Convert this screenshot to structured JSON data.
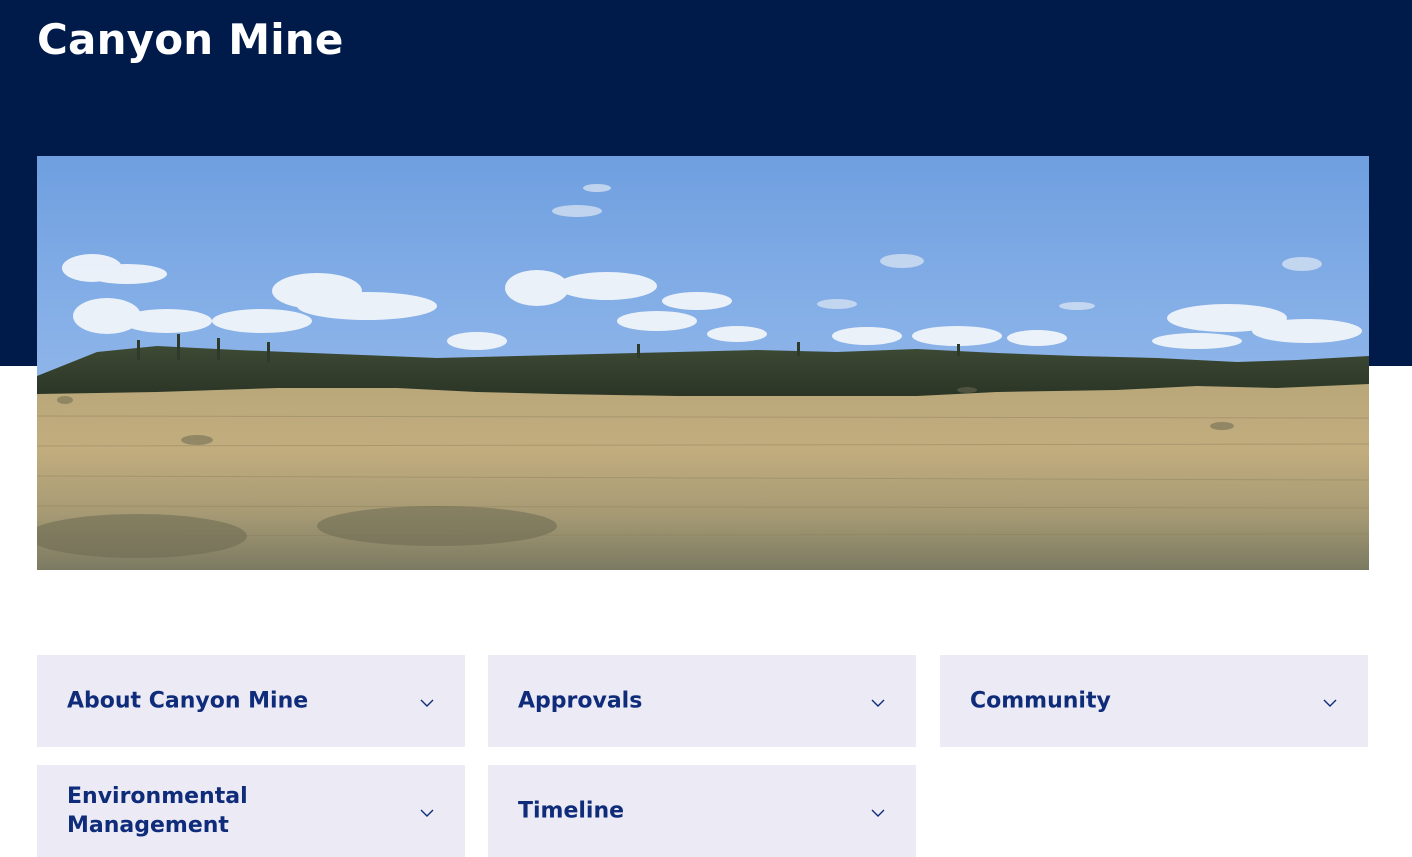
{
  "page": {
    "title": "Canyon Mine",
    "hero_image": "grassland-panorama-with-pine-treeline"
  },
  "colors": {
    "header_background": "#001a4a",
    "accordion_background": "#ebeaf5",
    "accordion_text": "#0f2c7a"
  },
  "accordions": [
    {
      "label": "About Canyon Mine",
      "icon": "chevron-down-icon"
    },
    {
      "label": "Approvals",
      "icon": "chevron-down-icon"
    },
    {
      "label": "Community",
      "icon": "chevron-down-icon"
    },
    {
      "label": "Environmental\nManagement",
      "icon": "chevron-down-icon"
    },
    {
      "label": "Timeline",
      "icon": "chevron-down-icon"
    }
  ]
}
